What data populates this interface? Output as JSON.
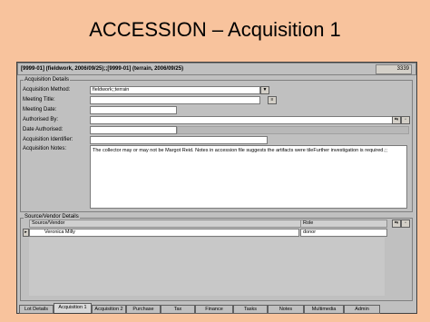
{
  "slide": {
    "title": "ACCESSION – Acquisition 1"
  },
  "window": {
    "title": "[9999-01] (fieldwork, 2006/09/25);;[9999-01] (terrain, 2006/09/25)",
    "record_number": "3339"
  },
  "details": {
    "group_label": "Acquisition Details",
    "labels": {
      "method": "Acquisition Method:",
      "meeting_title": "Meeting Title:",
      "meeting_date": "Meeting Date:",
      "authorised_by": "Authorised By:",
      "date_authorised": "Date Authorised:",
      "identifier": "Acquisition Identifier:",
      "notes": "Acquisition Notes:"
    },
    "values": {
      "method": "fieldwork;;terrain",
      "meeting_title": "",
      "meeting_date": "",
      "authorised_by": "",
      "date_authorised": "",
      "identifier": "",
      "notes": "The collector may or may not be Margot Reid. Notes in accession file suggests the artifacts were tileFurther investigation is required.;;"
    }
  },
  "vendor": {
    "group_label": "Source/Vendor Details",
    "columns": [
      "Source/Vendor",
      "Role"
    ],
    "rows": [
      {
        "name": "Veronica Milly",
        "role": "donor"
      }
    ]
  },
  "tabs": [
    "Lot Details",
    "Acquisition 1",
    "Acquisition 2",
    "Purchase",
    "Tax",
    "Finance",
    "Tasks",
    "Notes",
    "Multimedia",
    "Admin"
  ],
  "active_tab": "Acquisition 1"
}
